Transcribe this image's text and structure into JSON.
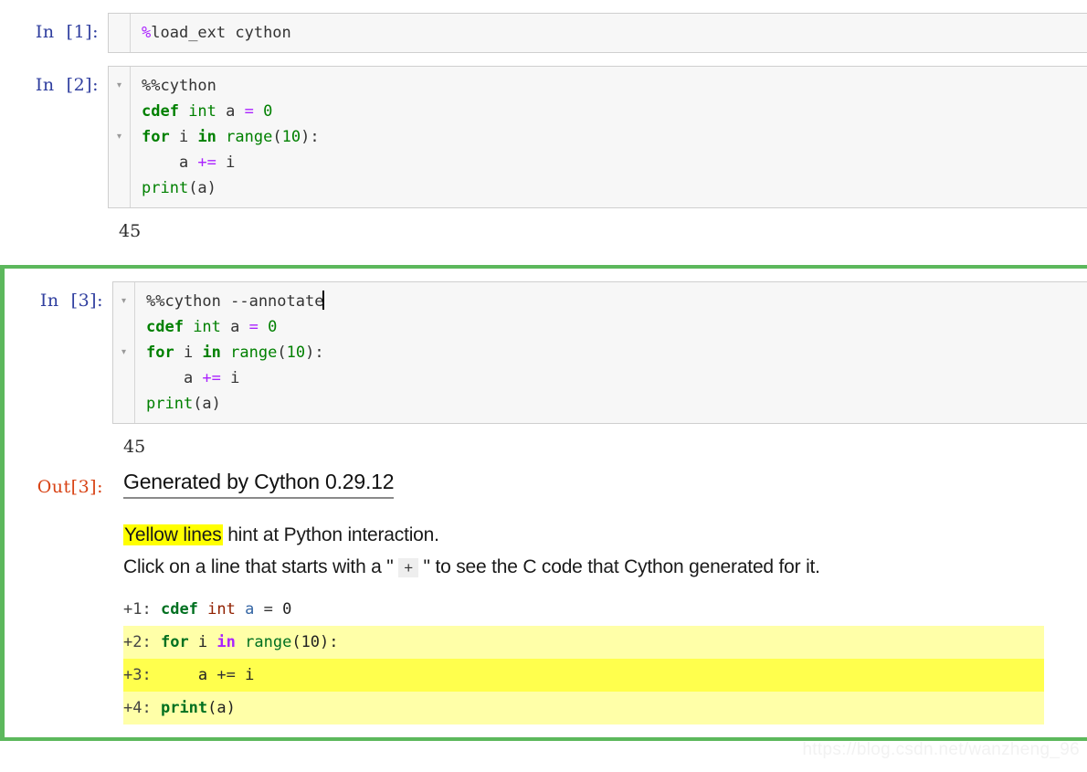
{
  "notebook": {
    "cells": [
      {
        "prompt": "In  [1]:",
        "folds": [
          " "
        ],
        "lines": [
          "%load_ext cython"
        ],
        "selected": false,
        "stdout": null
      },
      {
        "prompt": "In  [2]:",
        "folds": [
          "▾",
          " ",
          "▾",
          " ",
          " "
        ],
        "lines": [
          "%%cython",
          "cdef int a = 0",
          "for i in range(10):",
          "    a += i",
          "print(a)"
        ],
        "selected": false,
        "stdout": "45"
      },
      {
        "prompt": "In  [3]:",
        "folds": [
          "▾",
          " ",
          "▾",
          " ",
          " "
        ],
        "lines": [
          "%%cython --annotate",
          "cdef int a = 0",
          "for i in range(10):",
          "    a += i",
          "print(a)"
        ],
        "selected": true,
        "stdout": "45"
      }
    ]
  },
  "output": {
    "prompt": "Out[3]:",
    "title": "Generated by Cython 0.29.12",
    "note_line1_highlight": "Yellow lines",
    "note_line1_rest": " hint at Python interaction.",
    "note_line2_a": "Click on a line that starts with a \" ",
    "note_line2_chip": "+",
    "note_line2_b": " \" to see the C code that Cython generated for it.",
    "annotated_lines": [
      {
        "number": "+1:",
        "score": 0,
        "code": "cdef int a = 0"
      },
      {
        "number": "+2:",
        "score": 1,
        "code": "for i in range(10):"
      },
      {
        "number": "+3:",
        "score": 2,
        "code": "    a += i"
      },
      {
        "number": "+4:",
        "score": 1,
        "code": "print(a)"
      }
    ]
  },
  "watermark": "https://blog.csdn.net/wanzheng_96",
  "colors": {
    "selected_cell_border": "#5cb85c",
    "in_prompt": "#303F9F",
    "out_prompt": "#D84315",
    "cell_background": "#f7f7f7",
    "highlight_yellow": "#ffff00",
    "annot_score1": "#ffffa8",
    "annot_score2": "#ffff4d",
    "keyword_green": "#008000",
    "operator_purple": "#AA22FF"
  }
}
